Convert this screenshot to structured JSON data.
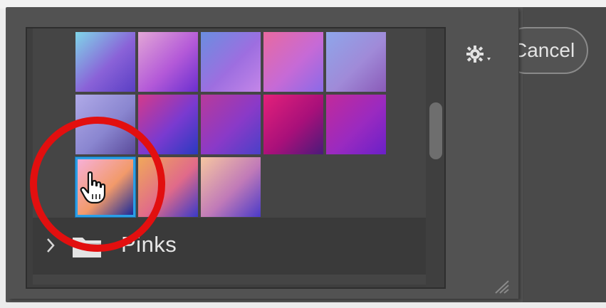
{
  "dialog": {
    "cancel_label": "Cancel",
    "gear_icon": "gear-icon"
  },
  "gradient_picker": {
    "group": {
      "label": "Pinks",
      "expand_icon": "chevron-right-icon",
      "folder_icon": "folder-icon"
    },
    "swatches": [
      {
        "row": 1,
        "col": 1,
        "colors": [
          "#7fd6e8",
          "#8a62d8",
          "#5a3fc4"
        ]
      },
      {
        "row": 1,
        "col": 2,
        "colors": [
          "#e2a6d6",
          "#b45ad8",
          "#6a2fd0"
        ]
      },
      {
        "row": 1,
        "col": 3,
        "colors": [
          "#6a8ee0",
          "#9d6ee0",
          "#c486e8"
        ]
      },
      {
        "row": 1,
        "col": 4,
        "colors": [
          "#e86aa0",
          "#c66ad6",
          "#8a6ae8"
        ]
      },
      {
        "row": 1,
        "col": 5,
        "colors": [
          "#8ea6ea",
          "#a08ad8",
          "#8a5ab8"
        ]
      },
      {
        "row": 2,
        "col": 1,
        "colors": [
          "#b0aae8",
          "#8a86d0",
          "#5a4a9a"
        ]
      },
      {
        "row": 2,
        "col": 2,
        "colors": [
          "#d43a8a",
          "#7a3ad0",
          "#2a3ac0"
        ]
      },
      {
        "row": 2,
        "col": 3,
        "colors": [
          "#b83a9a",
          "#8a3ac8",
          "#4a40c8"
        ]
      },
      {
        "row": 2,
        "col": 4,
        "colors": [
          "#e4207a",
          "#a8107a",
          "#4a1a7a"
        ]
      },
      {
        "row": 2,
        "col": 5,
        "colors": [
          "#c22a9a",
          "#9a2ac0",
          "#6a20c8"
        ]
      },
      {
        "row": 3,
        "col": 1,
        "colors": [
          "#f6b0d8",
          "#f29a6a",
          "#1a2a9a"
        ],
        "selected": true
      },
      {
        "row": 3,
        "col": 2,
        "colors": [
          "#f0a85a",
          "#e06a8a",
          "#3a3ac8"
        ]
      },
      {
        "row": 3,
        "col": 3,
        "colors": [
          "#f6c6a0",
          "#c07ab8",
          "#4a3ac8"
        ]
      }
    ],
    "scrollbar_label": "scrollbar",
    "resize_icon": "resize-grip-icon"
  },
  "annotation": {
    "circle_color": "#e20f0f",
    "cursor_icon": "hand-cursor-icon"
  },
  "colors": {
    "panel": "#525252",
    "list_bg": "#454545",
    "selection": "#2b9fe6",
    "text": "#e6e6e6"
  }
}
